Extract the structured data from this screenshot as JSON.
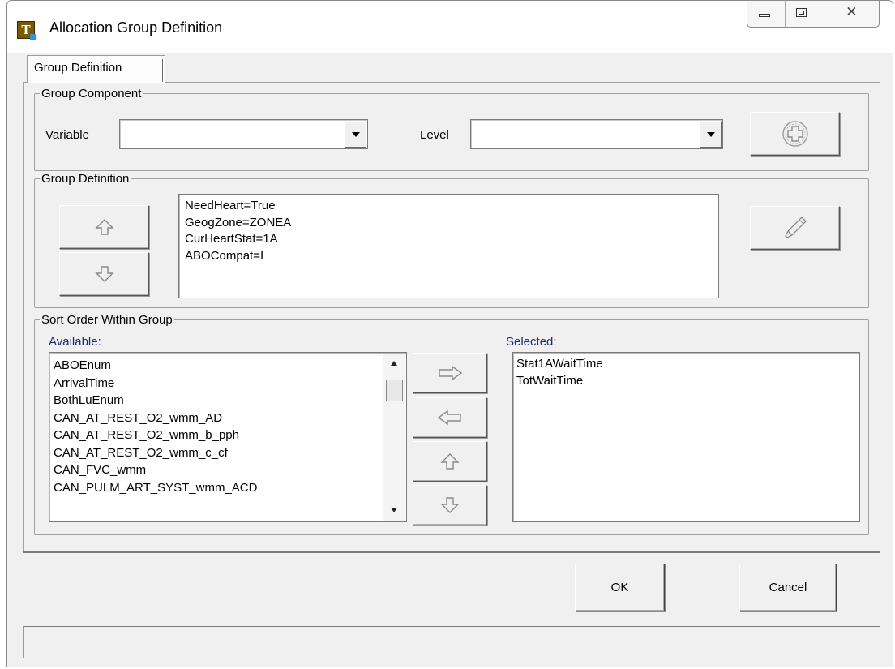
{
  "window": {
    "title": "Allocation Group Definition",
    "icon_letter": "T"
  },
  "tabs": [
    {
      "label": "Group Definition"
    }
  ],
  "group_component": {
    "legend": "Group Component",
    "variable_label": "Variable",
    "variable_value": "",
    "level_label": "Level",
    "level_value": "",
    "add_icon": "plus-circle-icon"
  },
  "group_definition": {
    "legend": "Group Definition",
    "items": [
      "NeedHeart=True",
      "GeogZone=ZONEA",
      "CurHeartStat=1A",
      "ABOCompat=I"
    ],
    "up_icon": "arrow-up-icon",
    "down_icon": "arrow-down-icon",
    "clear_icon": "eraser-icon"
  },
  "sort_order": {
    "legend": "Sort Order Within Group",
    "available_label": "Available:",
    "selected_label": "Selected:",
    "available": [
      "ABOEnum",
      "ArrivalTime",
      "BothLuEnum",
      "CAN_AT_REST_O2_wmm_AD",
      "CAN_AT_REST_O2_wmm_b_pph",
      "CAN_AT_REST_O2_wmm_c_cf",
      "CAN_FVC_wmm",
      "CAN_PULM_ART_SYST_wmm_ACD"
    ],
    "selected": [
      "Stat1AWaitTime",
      "TotWaitTime"
    ]
  },
  "buttons": {
    "ok": "OK",
    "cancel": "Cancel"
  },
  "status": ""
}
